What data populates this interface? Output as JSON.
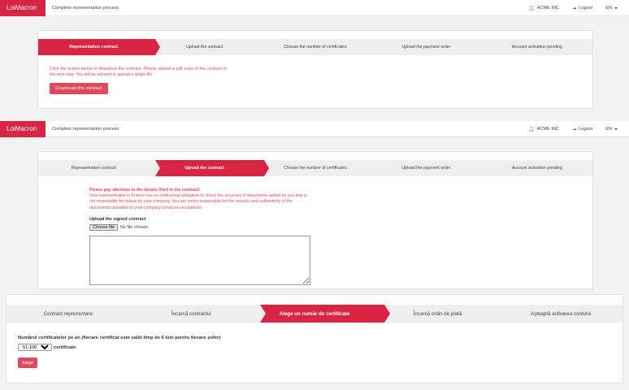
{
  "brand": "LoiMacron",
  "nav": {
    "title": "Complete representation process",
    "company": "ACME INC",
    "logout": "Logout",
    "lang": "EN"
  },
  "panel1": {
    "steps": [
      "Representation contract",
      "Upload the contract",
      "Choose the number of certificates",
      "Upload the payment order",
      "Account activation pending"
    ],
    "active_step": 0,
    "instructions": "Click the button below to download the contract. Please upload a pdf scan of the contract in the next step. You will be allowed to upload a single file.",
    "download_button": "Download the contract"
  },
  "panel2": {
    "steps": [
      "Representation contract",
      "Upload the contract",
      "Choose the number of certificates",
      "Upload the payment order",
      "Account activation pending"
    ],
    "active_step": 1,
    "warning_title": "Please pay attention to the details filled in the contract!",
    "warning_body": "Your representative in France has no contractual obligation to check the accuracy of documents added by you and is not responsible for failure by your company. You are solely responsible for the veracity and authenticity of the documents uploaded to your company lomacron.eu platform.",
    "upload_label": "Upload the signed contract",
    "choose_file": "Choose file",
    "no_file": "No file chosen"
  },
  "panel3": {
    "steps": [
      "Contract reprezentare",
      "Încarcă contractul",
      "Alege un număr de certificate",
      "Încarcă ordin de plată",
      "Așteaptă activarea contului"
    ],
    "active_step": 2,
    "question": "Numărul certificatelor pe an (fiecare certificat este valid timp de 6 luni pentru fiecare șofer)",
    "selected_option": "51-100",
    "suffix": "certificate",
    "submit": "Alege"
  },
  "colors": {
    "accent": "#d92443",
    "link_red": "#e0485e"
  },
  "icons": {
    "user": "user-icon",
    "logout": "logout-icon"
  }
}
